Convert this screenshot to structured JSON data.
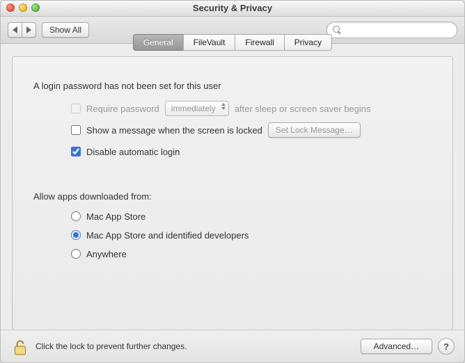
{
  "window": {
    "title": "Security & Privacy"
  },
  "toolbar": {
    "show_all": "Show All"
  },
  "search": {
    "placeholder": ""
  },
  "tabs": [
    {
      "label": "General",
      "selected": true
    },
    {
      "label": "FileVault",
      "selected": false
    },
    {
      "label": "Firewall",
      "selected": false
    },
    {
      "label": "Privacy",
      "selected": false
    }
  ],
  "general": {
    "login_heading": "A login password has not been set for this user",
    "require_password": {
      "label": "Require password",
      "checked": false,
      "enabled": false,
      "dropdown_value": "immediately",
      "suffix": "after sleep or screen saver begins"
    },
    "show_message": {
      "label": "Show a message when the screen is locked",
      "checked": false,
      "button": "Set Lock Message…",
      "button_enabled": false
    },
    "disable_auto_login": {
      "label": "Disable automatic login",
      "checked": true
    },
    "allow_heading": "Allow apps downloaded from:",
    "allow_options": [
      {
        "label": "Mac App Store",
        "selected": false
      },
      {
        "label": "Mac App Store and identified developers",
        "selected": true
      },
      {
        "label": "Anywhere",
        "selected": false
      }
    ]
  },
  "footer": {
    "lock_text": "Click the lock to prevent further changes.",
    "advanced": "Advanced…",
    "help": "?"
  }
}
